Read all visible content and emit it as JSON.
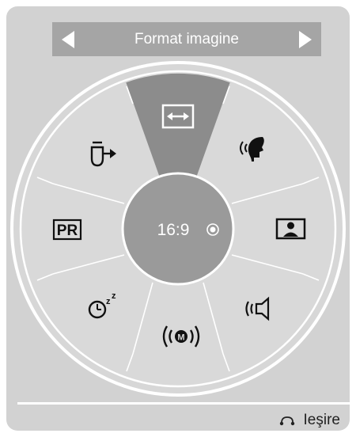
{
  "header": {
    "title": "Format imagine"
  },
  "center": {
    "label": "16:9"
  },
  "menu_items": [
    {
      "name": "aspect-ratio",
      "icon": "aspect-ratio-icon",
      "selected": true
    },
    {
      "name": "clear-voice",
      "icon": "speaking-head-icon"
    },
    {
      "name": "picture-mode",
      "icon": "person-picture-icon"
    },
    {
      "name": "sound-mode",
      "icon": "speaker-icon"
    },
    {
      "name": "mts",
      "icon": "m-broadcast-icon"
    },
    {
      "name": "sleep-timer",
      "icon": "sleep-timer-icon"
    },
    {
      "name": "pr-edit",
      "icon": "pr-icon"
    },
    {
      "name": "input-source",
      "icon": "input-plug-icon"
    }
  ],
  "footer": {
    "exit_label": "Ieşire",
    "exit_icon": "return-arrow-icon"
  },
  "colors": {
    "panel": "#d2d2d2",
    "title_bar": "#a5a5a5",
    "wheel": "#d9d9d9",
    "selected_wedge": "#8c8c8c",
    "center": "#9a9a9a",
    "icon": "#111111"
  }
}
